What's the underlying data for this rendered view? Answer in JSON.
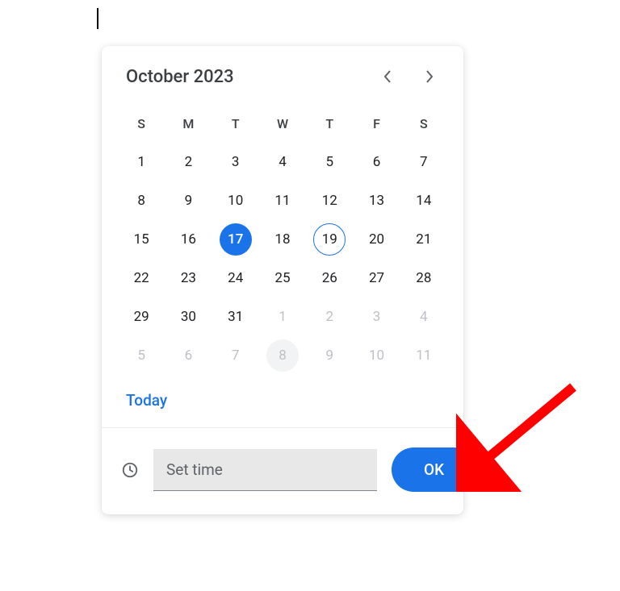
{
  "header": {
    "month_year": "October 2023"
  },
  "weekdays": [
    "S",
    "M",
    "T",
    "W",
    "T",
    "F",
    "S"
  ],
  "weeks": [
    [
      {
        "d": "1",
        "other": false
      },
      {
        "d": "2",
        "other": false
      },
      {
        "d": "3",
        "other": false
      },
      {
        "d": "4",
        "other": false
      },
      {
        "d": "5",
        "other": false
      },
      {
        "d": "6",
        "other": false
      },
      {
        "d": "7",
        "other": false
      }
    ],
    [
      {
        "d": "8",
        "other": false
      },
      {
        "d": "9",
        "other": false
      },
      {
        "d": "10",
        "other": false
      },
      {
        "d": "11",
        "other": false
      },
      {
        "d": "12",
        "other": false
      },
      {
        "d": "13",
        "other": false
      },
      {
        "d": "14",
        "other": false
      }
    ],
    [
      {
        "d": "15",
        "other": false
      },
      {
        "d": "16",
        "other": false
      },
      {
        "d": "17",
        "other": false,
        "selected": true
      },
      {
        "d": "18",
        "other": false
      },
      {
        "d": "19",
        "other": false,
        "today": true
      },
      {
        "d": "20",
        "other": false
      },
      {
        "d": "21",
        "other": false
      }
    ],
    [
      {
        "d": "22",
        "other": false
      },
      {
        "d": "23",
        "other": false
      },
      {
        "d": "24",
        "other": false
      },
      {
        "d": "25",
        "other": false
      },
      {
        "d": "26",
        "other": false
      },
      {
        "d": "27",
        "other": false
      },
      {
        "d": "28",
        "other": false
      }
    ],
    [
      {
        "d": "29",
        "other": false
      },
      {
        "d": "30",
        "other": false
      },
      {
        "d": "31",
        "other": false
      },
      {
        "d": "1",
        "other": true
      },
      {
        "d": "2",
        "other": true
      },
      {
        "d": "3",
        "other": true
      },
      {
        "d": "4",
        "other": true
      }
    ],
    [
      {
        "d": "5",
        "other": true
      },
      {
        "d": "6",
        "other": true
      },
      {
        "d": "7",
        "other": true
      },
      {
        "d": "8",
        "other": true,
        "hover": true
      },
      {
        "d": "9",
        "other": true
      },
      {
        "d": "10",
        "other": true
      },
      {
        "d": "11",
        "other": true
      }
    ]
  ],
  "today_label": "Today",
  "time": {
    "placeholder": "Set time",
    "value": ""
  },
  "ok_label": "OK",
  "colors": {
    "accent": "#1a73e8",
    "arrow": "#ff0000"
  }
}
